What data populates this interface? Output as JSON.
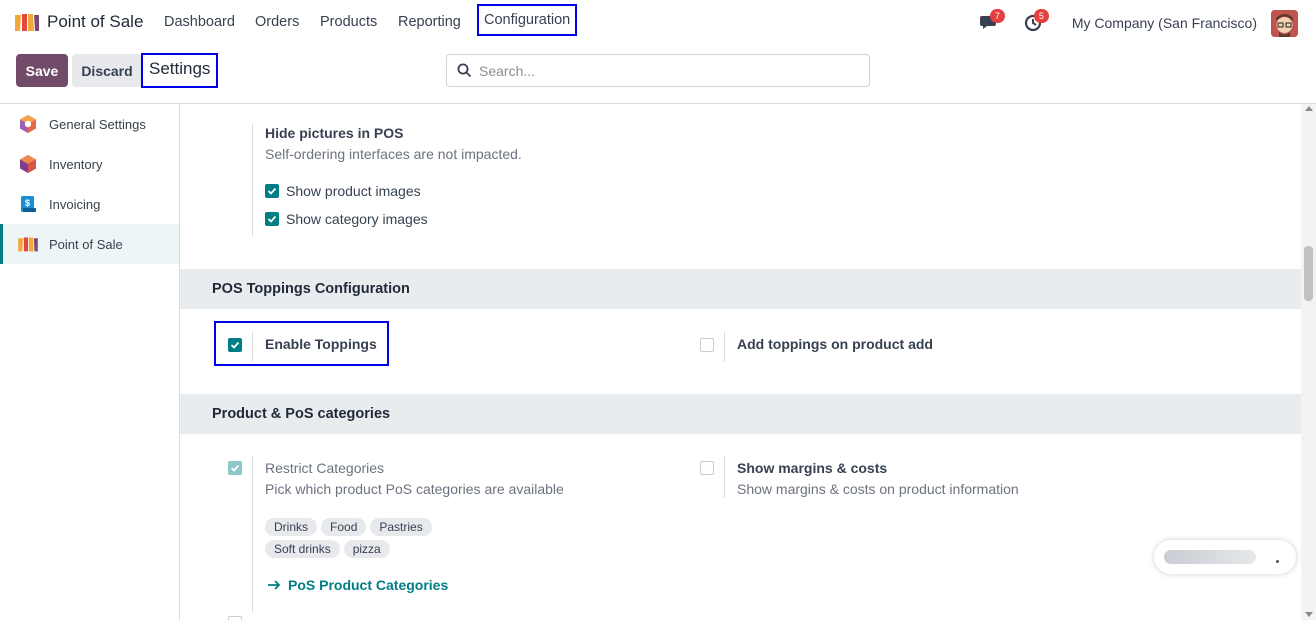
{
  "navbar": {
    "app_title": "Point of Sale",
    "menu": [
      "Dashboard",
      "Orders",
      "Products",
      "Reporting",
      "Configuration"
    ],
    "messages_count": "7",
    "activities_count": "5",
    "company": "My Company (San Francisco)"
  },
  "control": {
    "save_label": "Save",
    "discard_label": "Discard",
    "breadcrumb": "Settings",
    "search_placeholder": "Search..."
  },
  "sidebar": {
    "items": [
      {
        "label": "General Settings",
        "icon": "general-settings-icon"
      },
      {
        "label": "Inventory",
        "icon": "inventory-icon"
      },
      {
        "label": "Invoicing",
        "icon": "invoicing-icon"
      },
      {
        "label": "Point of Sale",
        "icon": "point-of-sale-icon"
      }
    ]
  },
  "main": {
    "hide_pictures": {
      "title": "Hide pictures in POS",
      "desc": "Self-ordering interfaces are not impacted.",
      "show_product_images": "Show product images",
      "show_category_images": "Show category images"
    },
    "toppings_section": {
      "heading": "POS Toppings Configuration",
      "enable_toppings": "Enable Toppings",
      "add_toppings": "Add toppings on product add"
    },
    "categories_section": {
      "heading": "Product & PoS categories",
      "restrict_title": "Restrict Categories",
      "restrict_desc": "Pick which product PoS categories are available",
      "tags": [
        "Drinks",
        "Food",
        "Pastries",
        "Soft drinks",
        "pizza"
      ],
      "link": "PoS Product Categories",
      "margins_title": "Show margins & costs",
      "margins_desc": "Show margins & costs on product information"
    }
  },
  "colors": {
    "brand": "#714b67",
    "accent": "#017e84",
    "highlight": "#0000e6",
    "badge": "#e53e3e"
  }
}
